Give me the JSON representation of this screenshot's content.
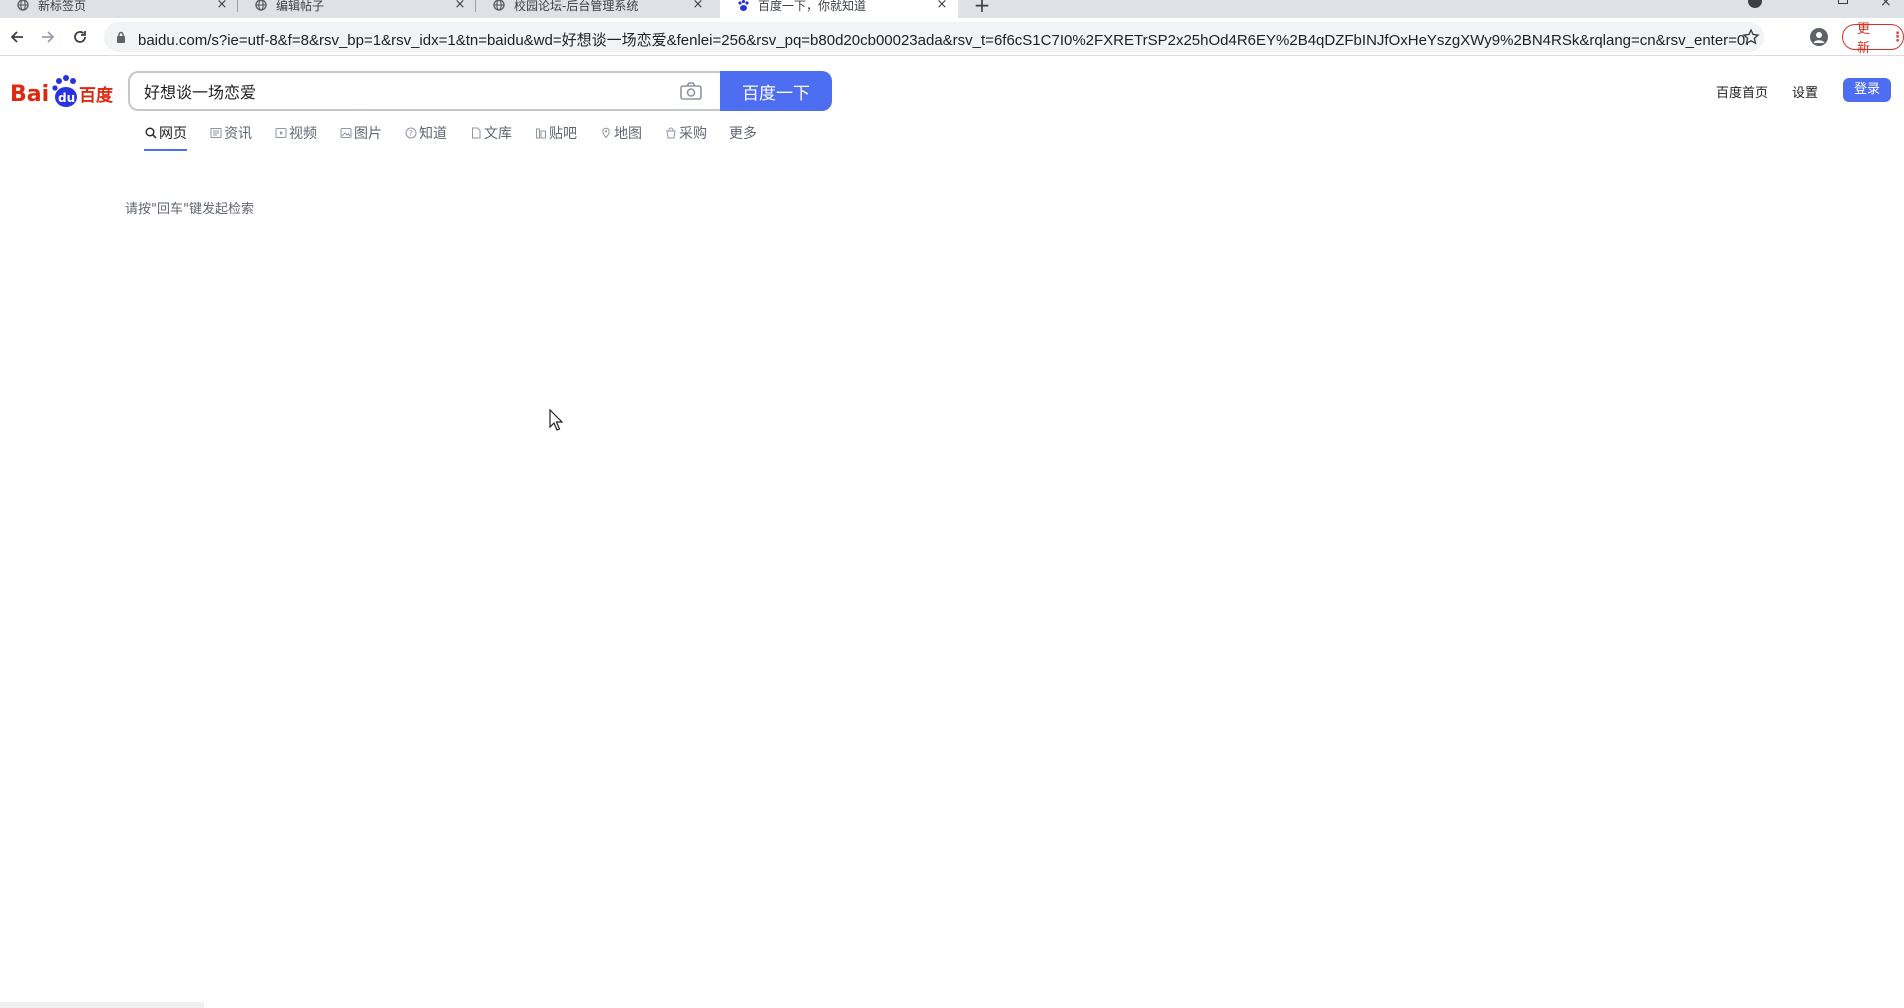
{
  "browser": {
    "tabs": [
      {
        "title": "新标签页",
        "icon": "globe-icon"
      },
      {
        "title": "编辑帖子",
        "icon": "globe-icon"
      },
      {
        "title": "校园论坛-后台管理系统",
        "icon": "globe-icon"
      },
      {
        "title": "百度一下，你就知道",
        "icon": "baidu-paw-icon",
        "active": true
      }
    ],
    "new_tab_label": "+",
    "close_glyph": "×",
    "url": "baidu.com/s?ie=utf-8&f=8&rsv_bp=1&rsv_idx=1&tn=baidu&wd=好想谈一场恋爱&fenlei=256&rsv_pq=b80d20cb00023ada&rsv_t=6f6cS1C7I0%2FXRETrSP2x25hOd4R6EY%2B4qDZFbINJfOxHeYszgXWy9%2BN4RSk&rqlang=cn&rsv_enter=0...",
    "update_label": "更新"
  },
  "baidu": {
    "logo_text": "Bai du 百度",
    "search": {
      "query": "好想谈一场恋爱",
      "button_label": "百度一下"
    },
    "top_links": {
      "home": "百度首页",
      "settings": "设置",
      "login": "登录"
    },
    "tabs": [
      {
        "label": "网页",
        "icon": "search-icon",
        "active": true
      },
      {
        "label": "资讯",
        "icon": "news-icon"
      },
      {
        "label": "视频",
        "icon": "video-icon"
      },
      {
        "label": "图片",
        "icon": "image-icon"
      },
      {
        "label": "知道",
        "icon": "question-icon"
      },
      {
        "label": "文库",
        "icon": "document-icon"
      },
      {
        "label": "贴吧",
        "icon": "tieba-icon"
      },
      {
        "label": "地图",
        "icon": "map-icon"
      },
      {
        "label": "采购",
        "icon": "shopping-icon"
      },
      {
        "label": "更多",
        "icon": ""
      }
    ],
    "hint": "请按\"回车\"键发起检索"
  },
  "colors": {
    "accent": "#4e6ef2",
    "logo_red": "#de2910",
    "logo_blue": "#2932e1"
  }
}
